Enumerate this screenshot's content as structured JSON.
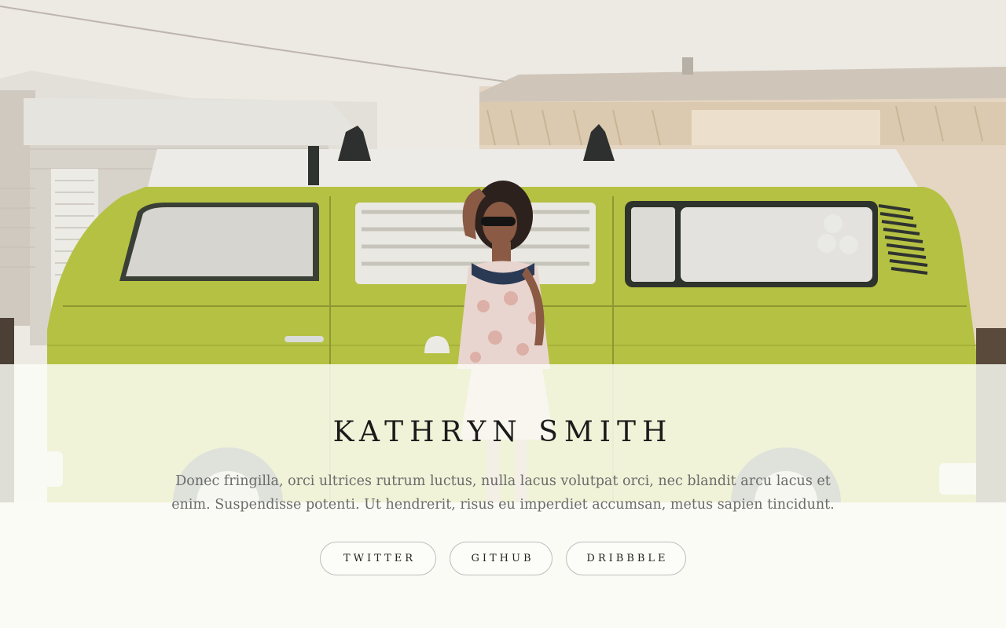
{
  "profile": {
    "name": "KATHRYN SMITH",
    "bio_line1": "Donec fringilla, orci ultrices rutrum luctus, nulla lacus volutpat orci, nec blandit arcu lacus et",
    "bio_line2": "enim. Suspendisse potenti. Ut hendrerit, risus eu imperdiet accumsan, metus sapien tincidunt."
  },
  "links": {
    "twitter": "TWITTER",
    "github": "GITHUB",
    "dribbble": "DRIBBBLE"
  },
  "colors": {
    "van": "#b3bf3e",
    "overlay": "#fcfdf6",
    "text_dark": "#1b1b1b",
    "text_muted": "#6b6b6b"
  }
}
